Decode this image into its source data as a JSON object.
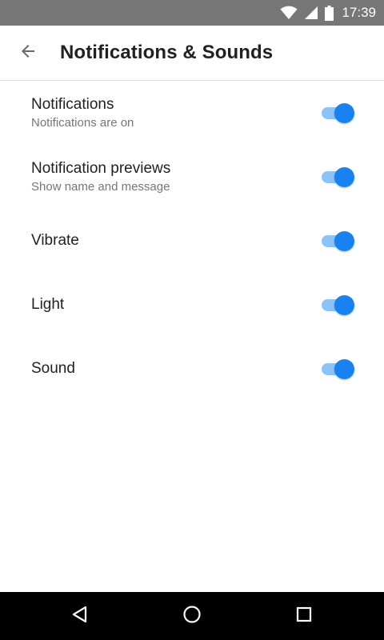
{
  "status_bar": {
    "time": "17:39",
    "icons": [
      "wifi-icon",
      "cell-signal-icon",
      "battery-icon"
    ]
  },
  "app_bar": {
    "title": "Notifications & Sounds",
    "back_icon": "arrow-back-icon"
  },
  "settings": [
    {
      "title": "Notifications",
      "subtitle": "Notifications are on",
      "enabled": true
    },
    {
      "title": "Notification previews",
      "subtitle": "Show name and message",
      "enabled": true
    },
    {
      "title": "Vibrate",
      "subtitle": "",
      "enabled": true
    },
    {
      "title": "Light",
      "subtitle": "",
      "enabled": true
    },
    {
      "title": "Sound",
      "subtitle": "",
      "enabled": true
    }
  ],
  "nav_bar": {
    "buttons": [
      "back-triangle-icon",
      "home-circle-icon",
      "recents-square-icon"
    ]
  },
  "colors": {
    "accent": "#1a82f0",
    "accent_track": "#8cc3f7",
    "status_bar": "#777777",
    "nav_bar": "#000000"
  }
}
